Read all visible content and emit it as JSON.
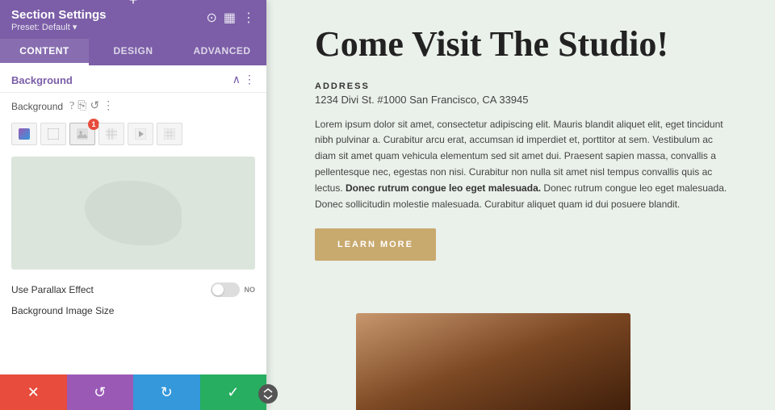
{
  "panel": {
    "add_btn": "+",
    "title": "Section Settings",
    "preset": "Preset: Default ▾",
    "tabs": [
      {
        "label": "Content",
        "active": true
      },
      {
        "label": "Design",
        "active": false
      },
      {
        "label": "Advanced",
        "active": false
      }
    ],
    "section_title": "Background",
    "bg_label": "Background",
    "bg_type_icons": [
      "🎨",
      "⬜",
      "📷",
      "▤",
      "✉",
      "🖼"
    ],
    "badge_number": "1",
    "parallax_label": "Use Parallax Effect",
    "toggle_no": "NO",
    "bg_image_size_label": "Background Image Size",
    "action_icons": {
      "cancel": "✕",
      "undo": "↺",
      "redo": "↻",
      "confirm": "✓"
    }
  },
  "content": {
    "title": "Come Visit The Studio!",
    "address_label": "ADDRESS",
    "address_value": "1234 Divi St. #1000 San Francisco, CA 33945",
    "body_text": "Lorem ipsum dolor sit amet, consectetur adipiscing elit. Mauris blandit aliquet elit, eget tincidunt nibh pulvinar a. Curabitur arcu erat, accumsan id imperdiet et, porttitor at sem. Vestibulum ac diam sit amet quam vehicula elementum sed sit amet dui. Praesent sapien massa, convallis a pellentesque nec, egestas non nisi. Curabitur non nulla sit amet nisl tempus convallis quis ac lectus. Donec rutrum congue leo eget malesuada. Donec rutrum congue leo eget malesuada. Donec sollicitudin molestie malesuada. Curabitur aliquet quam id dui posuere blandit.",
    "learn_more": "LEARN MORE"
  }
}
